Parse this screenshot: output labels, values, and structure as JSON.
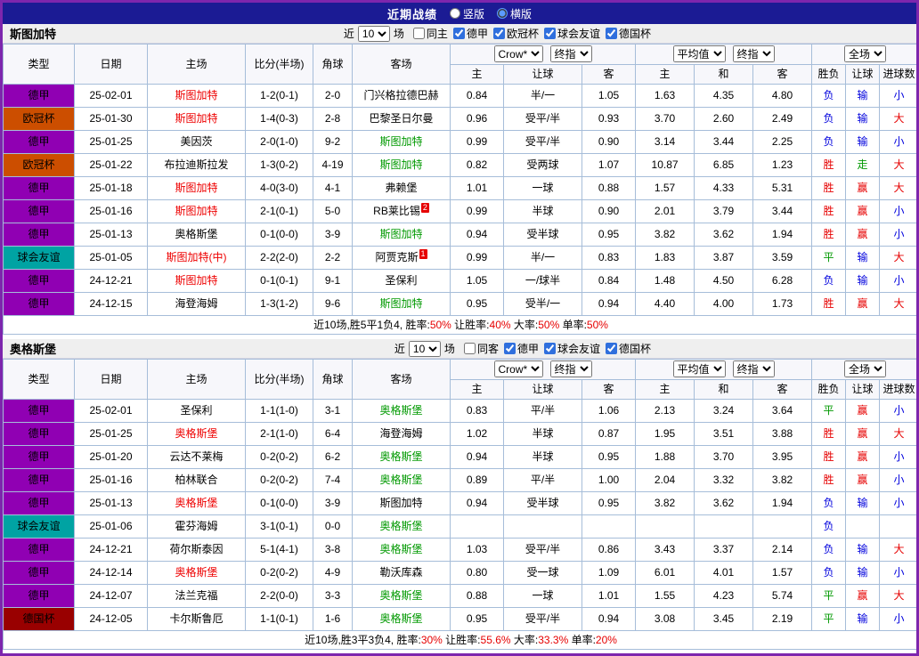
{
  "page": {
    "title": "近期战绩",
    "views": [
      {
        "label": "竖版",
        "selected": false
      },
      {
        "label": "横版",
        "selected": true
      }
    ]
  },
  "labels": {
    "near": "近",
    "matches": "场"
  },
  "columns": {
    "type": "类型",
    "date": "日期",
    "home": "主场",
    "score": "比分(半场)",
    "corner": "角球",
    "away": "客场",
    "odds_home": "主",
    "odds_handicap": "让球",
    "odds_away": "客",
    "avg_home": "主",
    "avg_draw": "和",
    "avg_away": "客",
    "result": "胜负",
    "handicap": "让球",
    "goals": "进球数"
  },
  "colors": {
    "frame_border": "#7d26ad",
    "topbar_bg": "#1b1b94",
    "grid_border": "#a6bdd9",
    "header_bg": "#f7f7fb",
    "section_bar_bg": "#efefef",
    "score": "#e60000",
    "self_home": "#ee0000",
    "self_away": "#009900",
    "league": {
      "德甲": "#9000b3",
      "欧冠杯": "#cc4e00",
      "球会友谊": "#00a3a3",
      "德国杯": "#990000"
    },
    "result_map": {
      "胜": "#e60000",
      "平": "#009900",
      "负": "#0000dd",
      "赢": "#e60000",
      "走": "#009900",
      "输": "#0000dd",
      "大": "#e60000",
      "小": "#0000dd"
    }
  },
  "sections": [
    {
      "team": "斯图加特",
      "filter": {
        "count": "10",
        "checkboxes": [
          {
            "label": "同主",
            "checked": false
          },
          {
            "label": "德甲",
            "checked": true
          },
          {
            "label": "欧冠杯",
            "checked": true
          },
          {
            "label": "球会友谊",
            "checked": true
          },
          {
            "label": "德国杯",
            "checked": true
          }
        ]
      },
      "selects": {
        "bookmaker": "Crow*",
        "bookmaker_time": "终指",
        "average": "平均值",
        "average_time": "终指",
        "scope": "全场"
      },
      "rows": [
        {
          "league": "德甲",
          "date": "25-02-01",
          "home": "斯图加特",
          "homeSelf": true,
          "score": "1-2(0-1)",
          "corner": "2-0",
          "away": "门兴格拉德巴赫",
          "awaySelf": false,
          "awayBadge": "",
          "oddsHome": "0.84",
          "oddsName": "半/一",
          "oddsAway": "1.05",
          "avgHome": "1.63",
          "avgDraw": "4.35",
          "avgAway": "4.80",
          "result": "负",
          "handicap": "输",
          "goals": "小"
        },
        {
          "league": "欧冠杯",
          "date": "25-01-30",
          "home": "斯图加特",
          "homeSelf": true,
          "score": "1-4(0-3)",
          "corner": "2-8",
          "away": "巴黎圣日尔曼",
          "awaySelf": false,
          "awayBadge": "",
          "oddsHome": "0.96",
          "oddsName": "受平/半",
          "oddsAway": "0.93",
          "avgHome": "3.70",
          "avgDraw": "2.60",
          "avgAway": "2.49",
          "result": "负",
          "handicap": "输",
          "goals": "大"
        },
        {
          "league": "德甲",
          "date": "25-01-25",
          "home": "美因茨",
          "homeSelf": false,
          "score": "2-0(1-0)",
          "corner": "9-2",
          "away": "斯图加特",
          "awaySelf": true,
          "awayBadge": "",
          "oddsHome": "0.99",
          "oddsName": "受平/半",
          "oddsAway": "0.90",
          "avgHome": "3.14",
          "avgDraw": "3.44",
          "avgAway": "2.25",
          "result": "负",
          "handicap": "输",
          "goals": "小"
        },
        {
          "league": "欧冠杯",
          "date": "25-01-22",
          "home": "布拉迪斯拉发",
          "homeSelf": false,
          "score": "1-3(0-2)",
          "corner": "4-19",
          "away": "斯图加特",
          "awaySelf": true,
          "awayBadge": "",
          "oddsHome": "0.82",
          "oddsName": "受两球",
          "oddsAway": "1.07",
          "avgHome": "10.87",
          "avgDraw": "6.85",
          "avgAway": "1.23",
          "result": "胜",
          "handicap": "走",
          "goals": "大"
        },
        {
          "league": "德甲",
          "date": "25-01-18",
          "home": "斯图加特",
          "homeSelf": true,
          "score": "4-0(3-0)",
          "corner": "4-1",
          "away": "弗赖堡",
          "awaySelf": false,
          "awayBadge": "",
          "oddsHome": "1.01",
          "oddsName": "一球",
          "oddsAway": "0.88",
          "avgHome": "1.57",
          "avgDraw": "4.33",
          "avgAway": "5.31",
          "result": "胜",
          "handicap": "赢",
          "goals": "大"
        },
        {
          "league": "德甲",
          "date": "25-01-16",
          "home": "斯图加特",
          "homeSelf": true,
          "score": "2-1(0-1)",
          "corner": "5-0",
          "away": "RB莱比锡",
          "awaySelf": false,
          "awayBadge": "2",
          "oddsHome": "0.99",
          "oddsName": "半球",
          "oddsAway": "0.90",
          "avgHome": "2.01",
          "avgDraw": "3.79",
          "avgAway": "3.44",
          "result": "胜",
          "handicap": "赢",
          "goals": "小"
        },
        {
          "league": "德甲",
          "date": "25-01-13",
          "home": "奥格斯堡",
          "homeSelf": false,
          "score": "0-1(0-0)",
          "corner": "3-9",
          "away": "斯图加特",
          "awaySelf": true,
          "awayBadge": "",
          "oddsHome": "0.94",
          "oddsName": "受半球",
          "oddsAway": "0.95",
          "avgHome": "3.82",
          "avgDraw": "3.62",
          "avgAway": "1.94",
          "result": "胜",
          "handicap": "赢",
          "goals": "小"
        },
        {
          "league": "球会友谊",
          "date": "25-01-05",
          "home": "斯图加特(中)",
          "homeSelf": true,
          "score": "2-2(2-0)",
          "corner": "2-2",
          "away": "阿贾克斯",
          "awaySelf": false,
          "awayBadge": "1",
          "oddsHome": "0.99",
          "oddsName": "半/一",
          "oddsAway": "0.83",
          "avgHome": "1.83",
          "avgDraw": "3.87",
          "avgAway": "3.59",
          "result": "平",
          "handicap": "输",
          "goals": "大"
        },
        {
          "league": "德甲",
          "date": "24-12-21",
          "home": "斯图加特",
          "homeSelf": true,
          "score": "0-1(0-1)",
          "corner": "9-1",
          "away": "圣保利",
          "awaySelf": false,
          "awayBadge": "",
          "oddsHome": "1.05",
          "oddsName": "一/球半",
          "oddsAway": "0.84",
          "avgHome": "1.48",
          "avgDraw": "4.50",
          "avgAway": "6.28",
          "result": "负",
          "handicap": "输",
          "goals": "小"
        },
        {
          "league": "德甲",
          "date": "24-12-15",
          "home": "海登海姆",
          "homeSelf": false,
          "score": "1-3(1-2)",
          "corner": "9-6",
          "away": "斯图加特",
          "awaySelf": true,
          "awayBadge": "",
          "oddsHome": "0.95",
          "oddsName": "受半/一",
          "oddsAway": "0.94",
          "avgHome": "4.40",
          "avgDraw": "4.00",
          "avgAway": "1.73",
          "result": "胜",
          "handicap": "赢",
          "goals": "大"
        }
      ],
      "summary": [
        {
          "text": "近10场,胜5平1负4, 胜率:",
          "color": "#000000"
        },
        {
          "text": "50%",
          "color": "#e60000"
        },
        {
          "text": " 让胜率:",
          "color": "#000000"
        },
        {
          "text": "40%",
          "color": "#e60000"
        },
        {
          "text": " 大率:",
          "color": "#000000"
        },
        {
          "text": "50%",
          "color": "#e60000"
        },
        {
          "text": " 单率:",
          "color": "#000000"
        },
        {
          "text": "50%",
          "color": "#e60000"
        }
      ]
    },
    {
      "team": "奥格斯堡",
      "filter": {
        "count": "10",
        "checkboxes": [
          {
            "label": "同客",
            "checked": false
          },
          {
            "label": "德甲",
            "checked": true
          },
          {
            "label": "球会友谊",
            "checked": true
          },
          {
            "label": "德国杯",
            "checked": true
          }
        ]
      },
      "selects": {
        "bookmaker": "Crow*",
        "bookmaker_time": "终指",
        "average": "平均值",
        "average_time": "终指",
        "scope": "全场"
      },
      "rows": [
        {
          "league": "德甲",
          "date": "25-02-01",
          "home": "圣保利",
          "homeSelf": false,
          "score": "1-1(1-0)",
          "corner": "3-1",
          "away": "奥格斯堡",
          "awaySelf": true,
          "awayBadge": "",
          "oddsHome": "0.83",
          "oddsName": "平/半",
          "oddsAway": "1.06",
          "avgHome": "2.13",
          "avgDraw": "3.24",
          "avgAway": "3.64",
          "result": "平",
          "handicap": "赢",
          "goals": "小"
        },
        {
          "league": "德甲",
          "date": "25-01-25",
          "home": "奥格斯堡",
          "homeSelf": true,
          "score": "2-1(1-0)",
          "corner": "6-4",
          "away": "海登海姆",
          "awaySelf": false,
          "awayBadge": "",
          "oddsHome": "1.02",
          "oddsName": "半球",
          "oddsAway": "0.87",
          "avgHome": "1.95",
          "avgDraw": "3.51",
          "avgAway": "3.88",
          "result": "胜",
          "handicap": "赢",
          "goals": "大"
        },
        {
          "league": "德甲",
          "date": "25-01-20",
          "home": "云达不莱梅",
          "homeSelf": false,
          "score": "0-2(0-2)",
          "corner": "6-2",
          "away": "奥格斯堡",
          "awaySelf": true,
          "awayBadge": "",
          "oddsHome": "0.94",
          "oddsName": "半球",
          "oddsAway": "0.95",
          "avgHome": "1.88",
          "avgDraw": "3.70",
          "avgAway": "3.95",
          "result": "胜",
          "handicap": "赢",
          "goals": "小"
        },
        {
          "league": "德甲",
          "date": "25-01-16",
          "home": "柏林联合",
          "homeSelf": false,
          "score": "0-2(0-2)",
          "corner": "7-4",
          "away": "奥格斯堡",
          "awaySelf": true,
          "awayBadge": "",
          "oddsHome": "0.89",
          "oddsName": "平/半",
          "oddsAway": "1.00",
          "avgHome": "2.04",
          "avgDraw": "3.32",
          "avgAway": "3.82",
          "result": "胜",
          "handicap": "赢",
          "goals": "小"
        },
        {
          "league": "德甲",
          "date": "25-01-13",
          "home": "奥格斯堡",
          "homeSelf": true,
          "score": "0-1(0-0)",
          "corner": "3-9",
          "away": "斯图加特",
          "awaySelf": false,
          "awayBadge": "",
          "oddsHome": "0.94",
          "oddsName": "受半球",
          "oddsAway": "0.95",
          "avgHome": "3.82",
          "avgDraw": "3.62",
          "avgAway": "1.94",
          "result": "负",
          "handicap": "输",
          "goals": "小"
        },
        {
          "league": "球会友谊",
          "date": "25-01-06",
          "home": "霍芬海姆",
          "homeSelf": false,
          "score": "3-1(0-1)",
          "corner": "0-0",
          "away": "奥格斯堡",
          "awaySelf": true,
          "awayBadge": "",
          "oddsHome": "",
          "oddsName": "",
          "oddsAway": "",
          "avgHome": "",
          "avgDraw": "",
          "avgAway": "",
          "result": "负",
          "handicap": "",
          "goals": ""
        },
        {
          "league": "德甲",
          "date": "24-12-21",
          "home": "荷尔斯泰因",
          "homeSelf": false,
          "score": "5-1(4-1)",
          "corner": "3-8",
          "away": "奥格斯堡",
          "awaySelf": true,
          "awayBadge": "",
          "oddsHome": "1.03",
          "oddsName": "受平/半",
          "oddsAway": "0.86",
          "avgHome": "3.43",
          "avgDraw": "3.37",
          "avgAway": "2.14",
          "result": "负",
          "handicap": "输",
          "goals": "大"
        },
        {
          "league": "德甲",
          "date": "24-12-14",
          "home": "奥格斯堡",
          "homeSelf": true,
          "score": "0-2(0-2)",
          "corner": "4-9",
          "away": "勒沃库森",
          "awaySelf": false,
          "awayBadge": "",
          "oddsHome": "0.80",
          "oddsName": "受一球",
          "oddsAway": "1.09",
          "avgHome": "6.01",
          "avgDraw": "4.01",
          "avgAway": "1.57",
          "result": "负",
          "handicap": "输",
          "goals": "小"
        },
        {
          "league": "德甲",
          "date": "24-12-07",
          "home": "法兰克福",
          "homeSelf": false,
          "score": "2-2(0-0)",
          "corner": "3-3",
          "away": "奥格斯堡",
          "awaySelf": true,
          "awayBadge": "",
          "oddsHome": "0.88",
          "oddsName": "一球",
          "oddsAway": "1.01",
          "avgHome": "1.55",
          "avgDraw": "4.23",
          "avgAway": "5.74",
          "result": "平",
          "handicap": "赢",
          "goals": "大"
        },
        {
          "league": "德国杯",
          "date": "24-12-05",
          "home": "卡尔斯鲁厄",
          "homeSelf": false,
          "score": "1-1(0-1)",
          "corner": "1-6",
          "away": "奥格斯堡",
          "awaySelf": true,
          "awayBadge": "",
          "oddsHome": "0.95",
          "oddsName": "受平/半",
          "oddsAway": "0.94",
          "avgHome": "3.08",
          "avgDraw": "3.45",
          "avgAway": "2.19",
          "result": "平",
          "handicap": "输",
          "goals": "小"
        }
      ],
      "summary": [
        {
          "text": "近10场,胜3平3负4, 胜率:",
          "color": "#000000"
        },
        {
          "text": "30%",
          "color": "#e60000"
        },
        {
          "text": " 让胜率:",
          "color": "#000000"
        },
        {
          "text": "55.6%",
          "color": "#e60000"
        },
        {
          "text": " 大率:",
          "color": "#000000"
        },
        {
          "text": "33.3%",
          "color": "#e60000"
        },
        {
          "text": " 单率:",
          "color": "#000000"
        },
        {
          "text": "20%",
          "color": "#e60000"
        }
      ]
    }
  ]
}
